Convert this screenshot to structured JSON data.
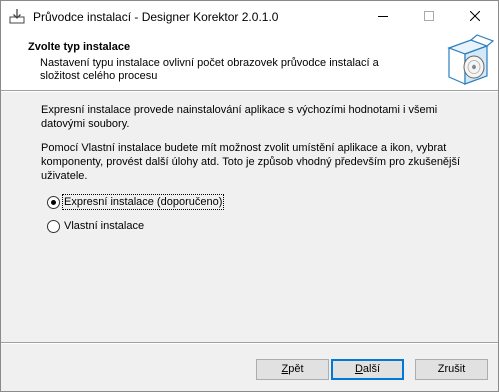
{
  "window": {
    "title": "Průvodce instalací - Designer Korektor 2.0.1.0"
  },
  "header": {
    "title": "Zvolte typ instalace",
    "description": "Nastavení typu instalace ovlivní počet obrazovek průvodce instalací a složitost celého procesu"
  },
  "body": {
    "paragraph1": "Expresní instalace provede nainstalování aplikace s výchozími hodnotami i všemi datovými soubory.",
    "paragraph2": "Pomocí Vlastní instalace budete mít možnost zvolit umístění aplikace a ikon, vybrat komponenty, provést další úlohy atd. Toto je způsob vhodný především pro zkušenější uživatele."
  },
  "options": [
    {
      "label": "Expresní instalace (doporučeno)",
      "selected": true
    },
    {
      "label": "Vlastní instalace",
      "selected": false
    }
  ],
  "buttons": {
    "back_first": "Z",
    "back_rest": "pět",
    "next_first": "D",
    "next_rest": "alší",
    "cancel": "Zrušit"
  },
  "icons": {
    "app": "installer-icon",
    "logo": "box-with-disc-icon"
  }
}
